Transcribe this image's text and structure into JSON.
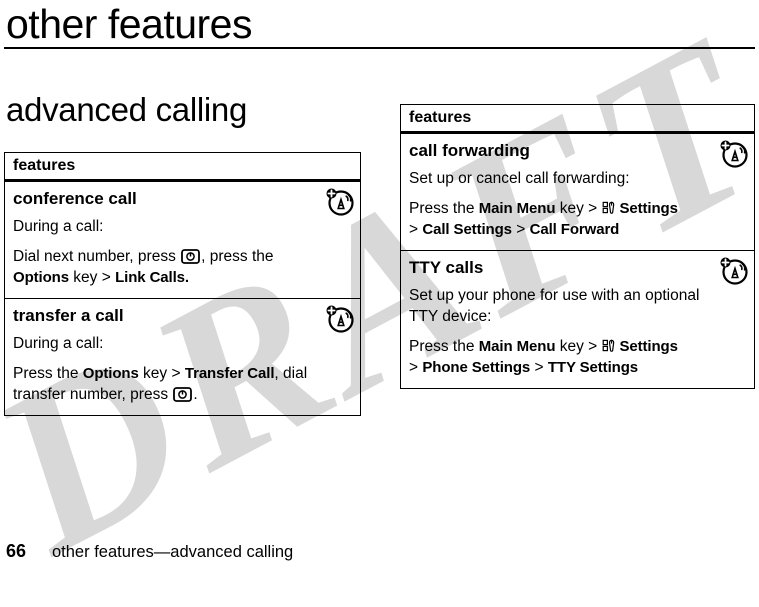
{
  "watermark": {
    "text": "DRAFT"
  },
  "header": {
    "title": "other features",
    "section_title": "advanced calling"
  },
  "left_table": {
    "header": "features",
    "rows": [
      {
        "title": "conference call",
        "icon": "network-feature-icon",
        "para1": "During a call:",
        "para2_a": "Dial next number, press ",
        "para2_key": "send-key-icon",
        "para2_b": ", press the ",
        "para2_c": "Options",
        "para2_d": " key > ",
        "para2_e": "Link Calls",
        "para2_f": "."
      },
      {
        "title": "transfer a call",
        "icon": "network-feature-icon",
        "para1": "During a call:",
        "para2_a": "Press the ",
        "para2_c": "Options",
        "para2_d": " key > ",
        "para2_e": "Transfer Call",
        "para2_f": ", dial transfer number, press ",
        "para2_key": "send-key-icon",
        "para2_g": "."
      }
    ]
  },
  "right_table": {
    "header": "features",
    "rows": [
      {
        "title": "call forwarding",
        "icon": "network-feature-icon",
        "para1": "Set up or cancel call forwarding:",
        "para2_a": "Press the ",
        "para2_b": "Main Menu",
        "para2_c": " key > ",
        "para2_tool": "settings-tool-icon",
        "para2_d": "Settings",
        "para2_e": " > ",
        "para2_f": "Call Settings",
        "para2_g": " > ",
        "para2_h": "Call Forward"
      },
      {
        "title": "TTY calls",
        "icon": "network-feature-icon",
        "para1": "Set up your phone for use with an optional TTY device:",
        "para2_a": "Press the ",
        "para2_b": "Main Menu",
        "para2_c": " key > ",
        "para2_tool": "settings-tool-icon",
        "para2_d": "Settings",
        "para2_e": " > ",
        "para2_f": "Phone Settings",
        "para2_g": " > ",
        "para2_h": "TTY Settings"
      }
    ]
  },
  "footer": {
    "page_number": "66",
    "text": "other features—advanced calling"
  },
  "colors": {
    "ink": "#000000",
    "paper": "#ffffff",
    "watermark": "#d8d8d8"
  }
}
